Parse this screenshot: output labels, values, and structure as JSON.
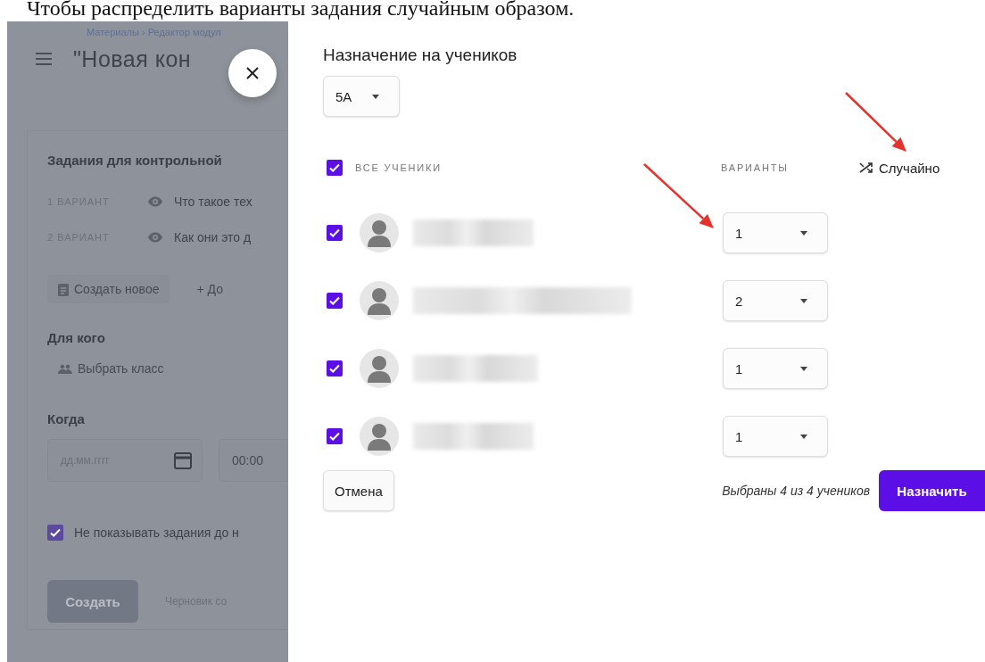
{
  "caption": "Чтобы распределить варианты задания случайным образом.",
  "background_page": {
    "breadcrumb": "Материалы › Редактор модул",
    "title": "\"Новая кон",
    "tasks_heading": "Задания для контрольной",
    "variants": [
      {
        "label": "1 ВАРИАНТ",
        "task": "Что такое тех"
      },
      {
        "label": "2 ВАРИАНТ",
        "task": "Как они это д"
      }
    ],
    "create_new": "Создать новое",
    "add": "+ До",
    "for_whom_heading": "Для кого",
    "choose_class": "Выбрать класс",
    "when_heading": "Когда",
    "date_placeholder": "дд.мм.гггг",
    "time_value": "00:00",
    "hide_tasks": {
      "label": "Не показывать задания до н",
      "checked": true
    },
    "create_button": {
      "label": "Создать",
      "disabled": true
    },
    "draft_status": "Черновик со"
  },
  "modal": {
    "title": "Назначение на учеников",
    "class_select": "5А",
    "select_all": {
      "label": "ВСЕ УЧЕНИКИ",
      "checked": true
    },
    "variants_heading": "ВАРИАНТЫ",
    "random_button": "Случайно",
    "random_button_arrow": true,
    "students": [
      {
        "checked": true,
        "variant": "1",
        "variant_arrow": true
      },
      {
        "checked": true,
        "variant": "2",
        "variant_arrow": false
      },
      {
        "checked": true,
        "variant": "1",
        "variant_arrow": false
      },
      {
        "checked": true,
        "variant": "1",
        "variant_arrow": false
      }
    ],
    "cancel_button": "Отмена",
    "selection_summary": "Выбраны 4 из 4 учеников",
    "assign_button": "Назначить"
  }
}
